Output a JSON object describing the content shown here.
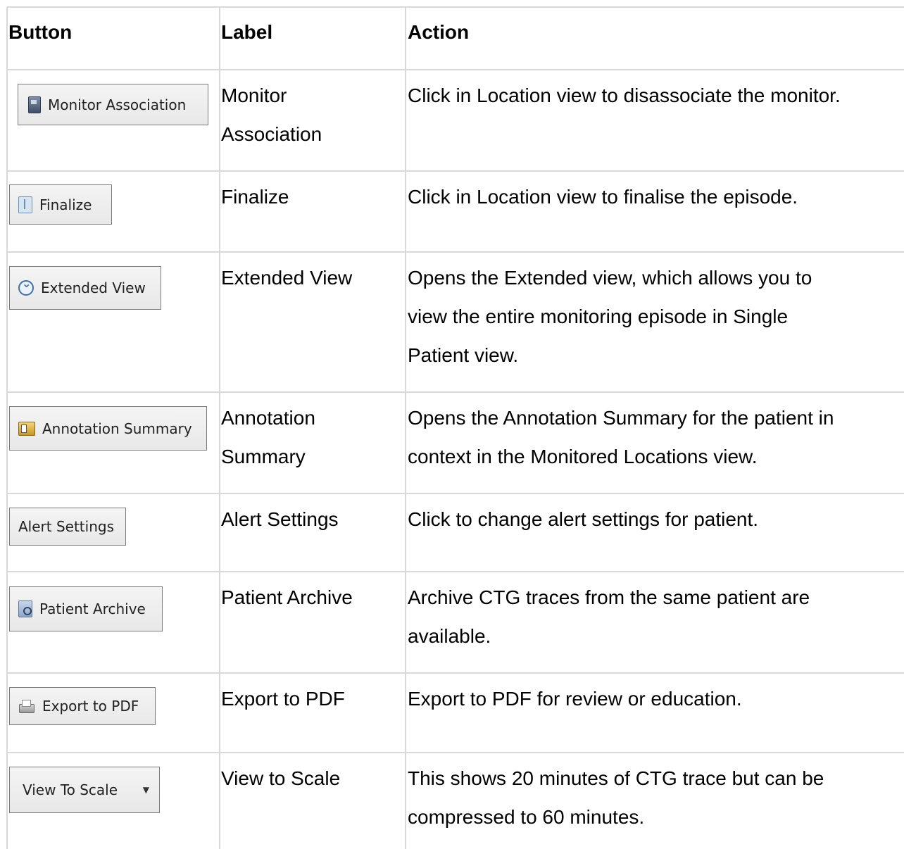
{
  "table": {
    "headers": {
      "button": "Button",
      "label": "Label",
      "action": "Action"
    },
    "rows": [
      {
        "button_text": "Monitor Association",
        "button_icon": "monitor-icon",
        "label_lines": [
          "Monitor",
          "Association"
        ],
        "action_lines": [
          "Click in Location view to disassociate the monitor."
        ]
      },
      {
        "button_text": "Finalize",
        "button_icon": "finalize-icon",
        "label_lines": [
          "Finalize"
        ],
        "action_lines": [
          "Click in Location view to finalise the episode."
        ]
      },
      {
        "button_text": "Extended View",
        "button_icon": "extended-view-icon",
        "label_lines": [
          "Extended View"
        ],
        "action_lines": [
          "Opens the Extended view, which allows you to",
          "view the entire monitoring episode in Single",
          "Patient view."
        ]
      },
      {
        "button_text": "Annotation Summary",
        "button_icon": "annotation-icon",
        "label_lines": [
          "Annotation",
          "Summary"
        ],
        "action_lines": [
          "Opens the Annotation Summary for the patient in",
          "context in the Monitored Locations view."
        ]
      },
      {
        "button_text": "Alert Settings",
        "button_icon": "",
        "label_lines": [
          "Alert Settings"
        ],
        "action_lines": [
          "Click to change alert settings for patient."
        ]
      },
      {
        "button_text": "Patient Archive",
        "button_icon": "archive-icon",
        "label_lines": [
          "Patient Archive"
        ],
        "action_lines": [
          "Archive CTG traces from the same patient are",
          "available."
        ]
      },
      {
        "button_text": "Export to PDF",
        "button_icon": "printer-icon",
        "label_lines": [
          "Export to PDF"
        ],
        "action_lines": [
          "Export to PDF for review or education."
        ]
      },
      {
        "button_text": "View To Scale",
        "button_icon": "dropdown-arrow-icon",
        "label_lines": [
          "View to Scale"
        ],
        "action_lines": [
          "This shows 20 minutes of CTG trace but can be",
          "compressed to 60 minutes."
        ]
      }
    ]
  }
}
